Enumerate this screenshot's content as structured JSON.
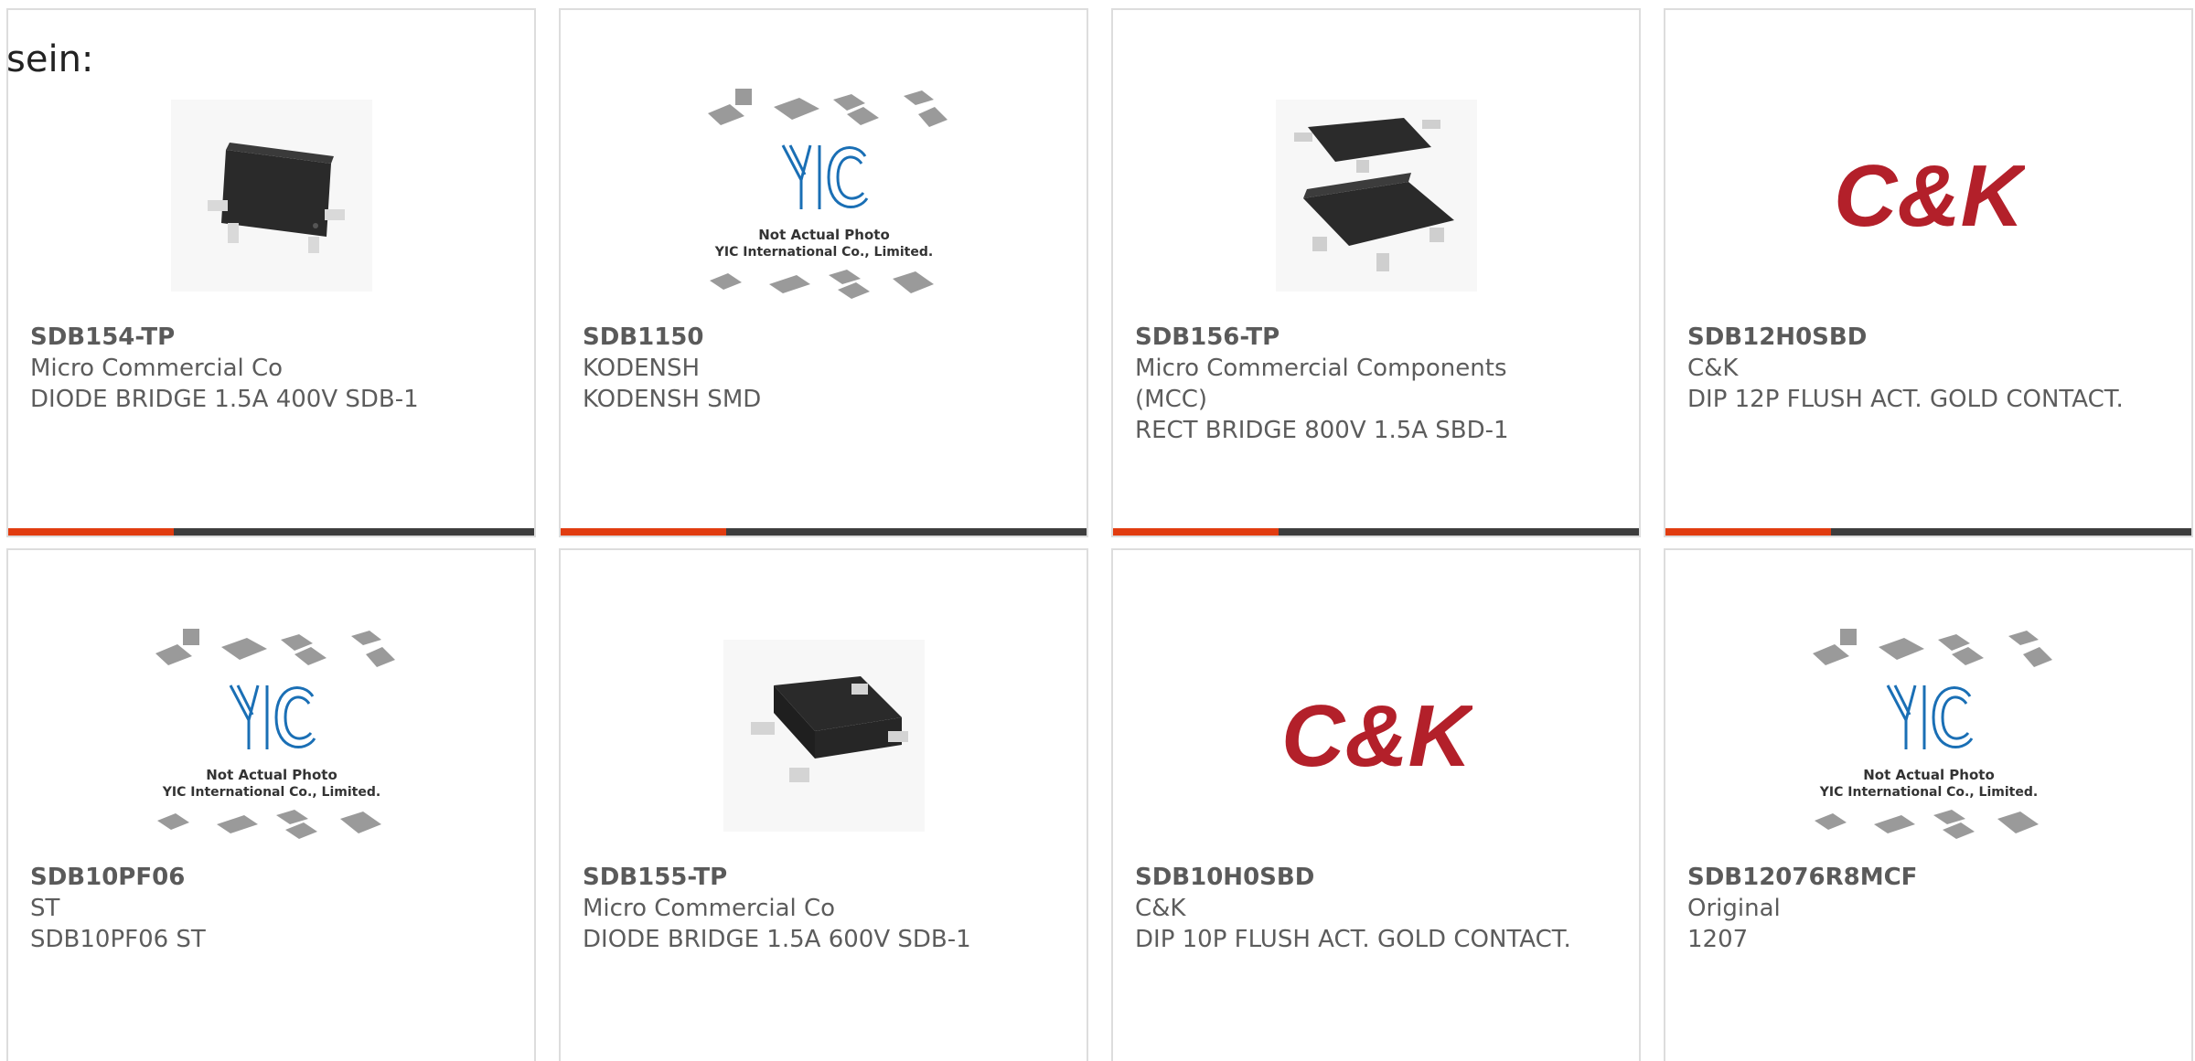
{
  "intro_text": "sein:",
  "icons": {
    "yic_placeholder": "yic-not-actual-photo-image",
    "ck_logo": "ck-brand-logo",
    "bridge_chip": "bridge-rectifier-chip-image"
  },
  "colors": {
    "accent": "#e13c10",
    "bar": "#3d3d3d",
    "border": "#dddddd",
    "text": "#5c5c5c",
    "ck_red": "#b3202a",
    "yic_blue": "#1a6fb5"
  },
  "placeholder_caption": {
    "line1": "Not Actual Photo",
    "line2": "YIC International Co., Limited."
  },
  "ck_logo_text": "C&K",
  "products": [
    {
      "part": "SDB154-TP",
      "manufacturer": "Micro Commercial Co",
      "description": "DIODE BRIDGE 1.5A 400V SDB-1",
      "image": "bridge_chip"
    },
    {
      "part": "SDB1150",
      "manufacturer": "KODENSH",
      "description": "KODENSH SMD",
      "image": "yic_placeholder"
    },
    {
      "part": "SDB156-TP",
      "manufacturer": "Micro Commercial Components (MCC)",
      "description": "RECT BRIDGE 800V 1.5A SBD-1",
      "image": "bridge_chip_pair"
    },
    {
      "part": "SDB12H0SBD",
      "manufacturer": "C&K",
      "description": "DIP 12P FLUSH ACT. GOLD CONTACT.",
      "image": "ck_logo"
    },
    {
      "part": "SDB10PF06",
      "manufacturer": "ST",
      "description": "SDB10PF06 ST",
      "image": "yic_placeholder"
    },
    {
      "part": "SDB155-TP",
      "manufacturer": "Micro Commercial Co",
      "description": "DIODE BRIDGE 1.5A 600V SDB-1",
      "image": "bridge_chip"
    },
    {
      "part": "SDB10H0SBD",
      "manufacturer": "C&K",
      "description": "DIP 10P FLUSH ACT. GOLD CONTACT.",
      "image": "ck_logo"
    },
    {
      "part": "SDB12076R8MCF",
      "manufacturer": "Original",
      "description": "1207",
      "image": "yic_placeholder"
    }
  ]
}
